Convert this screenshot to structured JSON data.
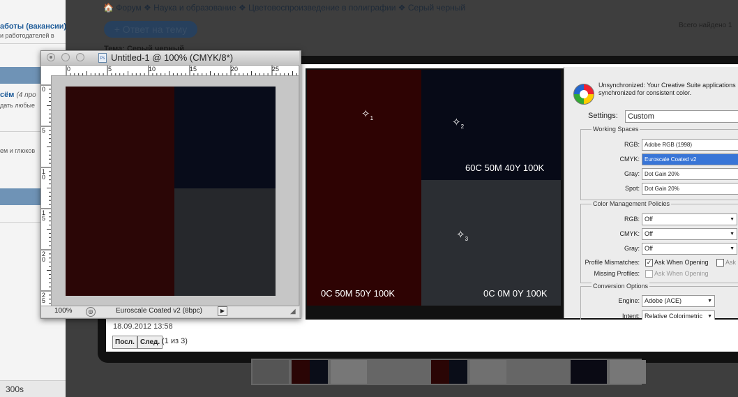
{
  "sidebar": {
    "link": "аботы (вакансии)",
    "link_sub": "и работодателей в",
    "post_title": "сём",
    "post_meta": "(4 про",
    "post_sub": "дать любые",
    "post2_sub": "ем и глюков",
    "bottom_label": "300s"
  },
  "forum": {
    "breadcrumb": "🏠 Форум ❖ Наука и образование ❖ Цветовоспроизведение в полиграфии ❖ Серый черный",
    "reply_button": "+ Ответ на тему",
    "found_text": "Всего найдено 1",
    "topic_label": "Тема: Серый черный"
  },
  "lightbox": {
    "date": "18.09.2012 13:58",
    "prev_button": "Посл.",
    "next_button": "След.",
    "counter": "(1 из 3)"
  },
  "screenshot": {
    "labels": {
      "blue": "60C 50M 40Y 100K",
      "red": "0C 50M 50Y 100K",
      "grey": "0C 0M 0Y 100K"
    },
    "samplers": [
      "1",
      "2",
      "3"
    ],
    "colors": {
      "red": "#2e0303",
      "blue": "#070a17",
      "grey": "#2b2e33"
    }
  },
  "color_settings": {
    "info": "Unsynchronized: Your Creative Suite applications synchronized for consistent color.",
    "settings_label": "Settings:",
    "settings_value": "Custom",
    "working_spaces_title": "Working Spaces",
    "rgb_label": "RGB:",
    "rgb_value": "Adobe RGB (1998)",
    "cmyk_label": "CMYK:",
    "cmyk_value": "Euroscale Coated v2",
    "gray_label": "Gray:",
    "gray_value": "Dot Gain 20%",
    "spot_label": "Spot:",
    "spot_value": "Dot Gain 20%",
    "policies_title": "Color Management Policies",
    "pol_rgb_label": "RGB:",
    "pol_rgb_value": "Off",
    "pol_cmyk_label": "CMYK:",
    "pol_cmyk_value": "Off",
    "pol_gray_label": "Gray:",
    "pol_gray_value": "Off",
    "mismatch_label": "Profile Mismatches:",
    "ask_opening": "Ask When Opening",
    "ask_short": "Ask",
    "missing_label": "Missing Profiles:",
    "ask_opening2": "Ask When Opening",
    "conversion_title": "Conversion Options",
    "engine_label": "Engine:",
    "engine_value": "Adobe (ACE)",
    "intent_label": "Intent:",
    "intent_value": "Relative Colorimetric"
  },
  "photoshop": {
    "title": "Untitled-1 @ 100% (CMYK/8*)",
    "doc_icon": "Ps",
    "zoom": "100%",
    "profile": "Euroscale Coated v2 (8bpc)",
    "ruler_top": [
      "0",
      "5",
      "10",
      "15",
      "20",
      "25"
    ],
    "ruler_left": [
      "0",
      "5",
      "1 0",
      "1 5",
      "2 0",
      "2 5"
    ],
    "colors": {
      "red": "#2b0606",
      "blue": "#080c1a",
      "grey": "#26282c"
    }
  }
}
